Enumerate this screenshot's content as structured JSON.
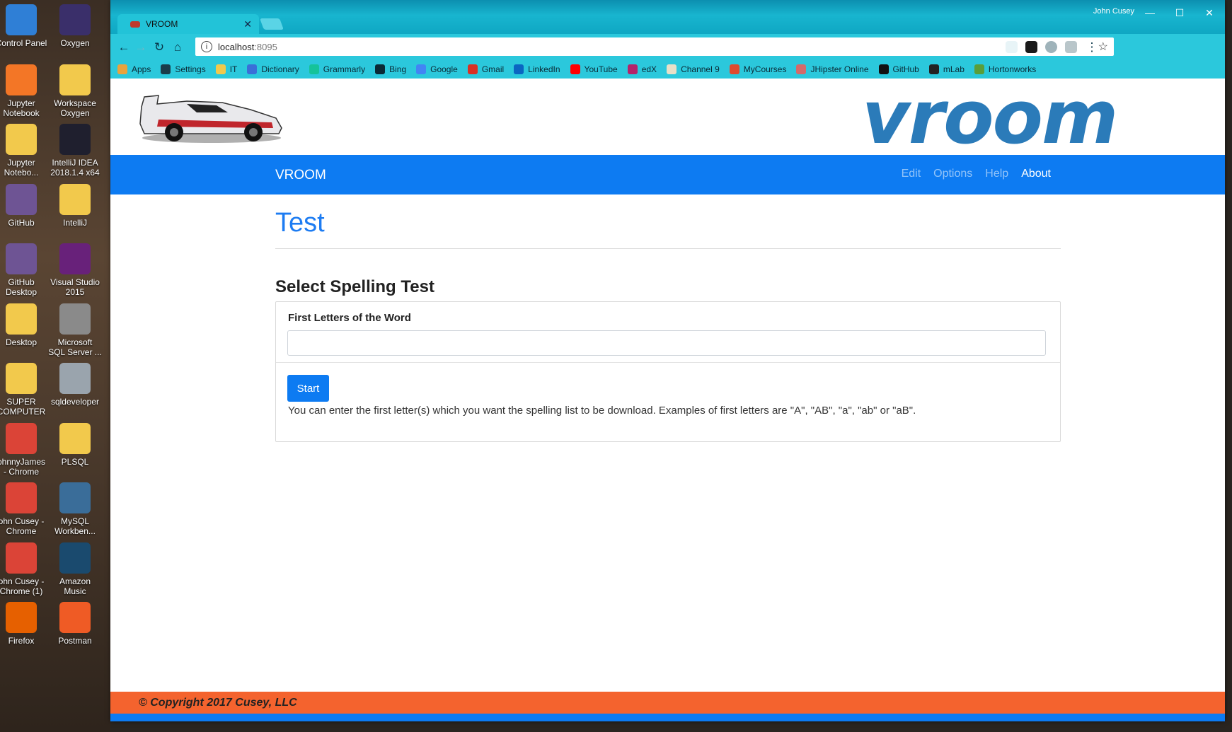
{
  "desktop": {
    "icons": [
      {
        "label": "Control Panel",
        "icon": "control-panel-icon",
        "color": "#2f7fd6"
      },
      {
        "label": "Oxygen",
        "icon": "eclipse-icon",
        "color": "#3a2f6a"
      },
      {
        "label": "Jupyter\nNotebook",
        "icon": "jupyter-icon",
        "color": "#f37626"
      },
      {
        "label": "Workspace\nOxygen",
        "icon": "folder-icon",
        "color": "#f2c94c"
      },
      {
        "label": "Jupyter\nNotebo...",
        "icon": "folder-icon",
        "color": "#f2c94c"
      },
      {
        "label": "IntelliJ IDEA\n2018.1.4 x64",
        "icon": "intellij-icon",
        "color": "#1f1f2e"
      },
      {
        "label": "GitHub",
        "icon": "github-icon",
        "color": "#6e5494"
      },
      {
        "label": "IntelliJ",
        "icon": "folder-icon",
        "color": "#f2c94c"
      },
      {
        "label": "GitHub\nDesktop",
        "icon": "github-desktop-icon",
        "color": "#6e5494"
      },
      {
        "label": "Visual Studio\n2015",
        "icon": "visual-studio-icon",
        "color": "#68217a"
      },
      {
        "label": "Desktop",
        "icon": "desktop-folder-icon",
        "color": "#f2c94c"
      },
      {
        "label": "Microsoft\nSQL Server ...",
        "icon": "sql-server-icon",
        "color": "#8a8a8a"
      },
      {
        "label": "SUPER\nCOMPUTER",
        "icon": "folder-icon",
        "color": "#f2c94c"
      },
      {
        "label": "sqldeveloper",
        "icon": "sqldeveloper-icon",
        "color": "#9aa4ad"
      },
      {
        "label": "ohnnyJames\n- Chrome",
        "icon": "chrome-icon",
        "color": "#db4437"
      },
      {
        "label": "PLSQL",
        "icon": "folder-icon",
        "color": "#f2c94c"
      },
      {
        "label": "ohn Cusey -\nChrome",
        "icon": "chrome-icon",
        "color": "#db4437"
      },
      {
        "label": "MySQL\nWorkben...",
        "icon": "mysql-workbench-icon",
        "color": "#3a6d99"
      },
      {
        "label": "ohn Cusey -\nChrome (1)",
        "icon": "chrome-icon",
        "color": "#db4437"
      },
      {
        "label": "Amazon\nMusic",
        "icon": "amazon-music-icon",
        "color": "#1a4a6e"
      },
      {
        "label": "Firefox",
        "icon": "firefox-icon",
        "color": "#e66000"
      },
      {
        "label": "Postman",
        "icon": "postman-icon",
        "color": "#ef5b25"
      }
    ]
  },
  "browser": {
    "tab_title": "VROOM",
    "user": "John Cusey",
    "address_host": "localhost",
    "address_port": ":8095",
    "bookmarks": [
      {
        "label": "Apps",
        "icon": "apps-grid-icon",
        "color": "#e8a33d"
      },
      {
        "label": "Settings",
        "icon": "gear-icon",
        "color": "#1a3d4a"
      },
      {
        "label": "IT",
        "icon": "folder-icon",
        "color": "#f2c94c"
      },
      {
        "label": "Dictionary",
        "icon": "dictionary-icon",
        "color": "#3a6fd8"
      },
      {
        "label": "Grammarly",
        "icon": "grammarly-icon",
        "color": "#15c39a"
      },
      {
        "label": "Bing",
        "icon": "bing-icon",
        "color": "#0a2a36"
      },
      {
        "label": "Google",
        "icon": "google-icon",
        "color": "#4285f4"
      },
      {
        "label": "Gmail",
        "icon": "gmail-icon",
        "color": "#d93025"
      },
      {
        "label": "LinkedIn",
        "icon": "linkedin-icon",
        "color": "#0a66c2"
      },
      {
        "label": "YouTube",
        "icon": "youtube-icon",
        "color": "#ff0000"
      },
      {
        "label": "edX",
        "icon": "edx-icon",
        "color": "#b4236a"
      },
      {
        "label": "Channel 9",
        "icon": "channel9-icon",
        "color": "#e8e0c8"
      },
      {
        "label": "MyCourses",
        "icon": "mycourses-icon",
        "color": "#e04a2f"
      },
      {
        "label": "JHipster Online",
        "icon": "jhipster-icon",
        "color": "#d46a6a"
      },
      {
        "label": "GitHub",
        "icon": "github-icon",
        "color": "#111111"
      },
      {
        "label": "mLab",
        "icon": "mlab-icon",
        "color": "#222222"
      },
      {
        "label": "Hortonworks",
        "icon": "hortonworks-icon",
        "color": "#5a9e3a"
      }
    ]
  },
  "app": {
    "logo_text": "vroom",
    "brand": "VROOM",
    "nav": [
      {
        "label": "Edit",
        "active": false
      },
      {
        "label": "Options",
        "active": false
      },
      {
        "label": "Help",
        "active": false
      },
      {
        "label": "About",
        "active": true
      }
    ],
    "page_title": "Test",
    "section_title": "Select Spelling Test",
    "form": {
      "label": "First Letters of the Word",
      "input_value": "",
      "start_label": "Start",
      "help_text": "You can enter the first letter(s) which you want the spelling list to be download. Examples of first letters are \"A\", \"AB\", \"a\", \"ab\" or \"aB\"."
    },
    "footer": "© Copyright 2017 Cusey, LLC",
    "colors": {
      "primary": "#0d7bf2",
      "footer": "#f4632e",
      "logo": "#2b7bb9"
    }
  }
}
